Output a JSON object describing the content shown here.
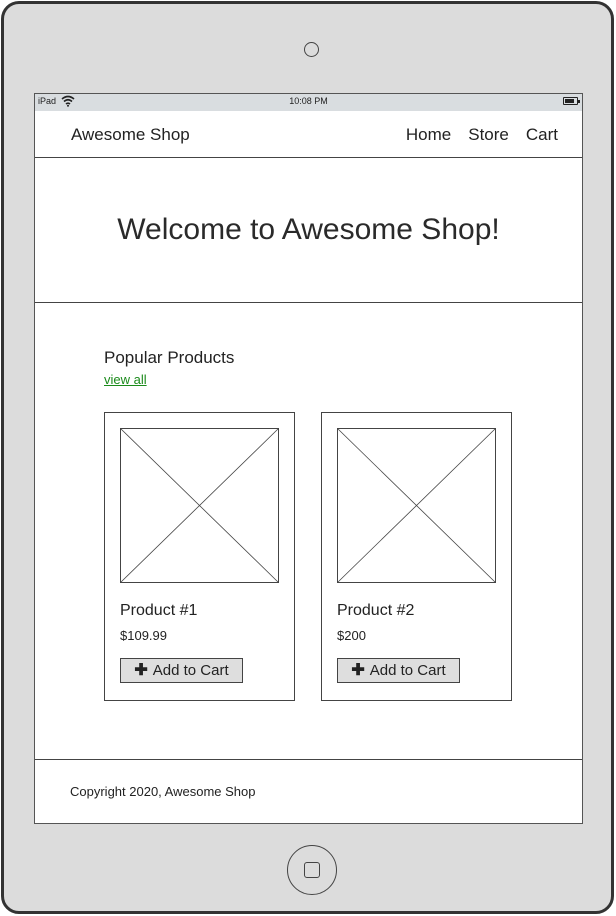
{
  "status_bar": {
    "device": "iPad",
    "time": "10:08 PM"
  },
  "navbar": {
    "brand": "Awesome Shop",
    "links": [
      "Home",
      "Store",
      "Cart"
    ]
  },
  "hero": {
    "title": "Welcome to Awesome Shop!"
  },
  "popular": {
    "title": "Popular Products",
    "view_all": "view all",
    "products": [
      {
        "name": "Product #1",
        "price": "$109.99",
        "button": "Add to Cart"
      },
      {
        "name": "Product #2",
        "price": "$200",
        "button": "Add to Cart"
      }
    ]
  },
  "footer": {
    "copyright": "Copyright 2020, Awesome Shop"
  },
  "colors": {
    "link": "#1a8a1a",
    "status_bar": "#d9dde0",
    "device_frame": "#dcdcdc"
  }
}
